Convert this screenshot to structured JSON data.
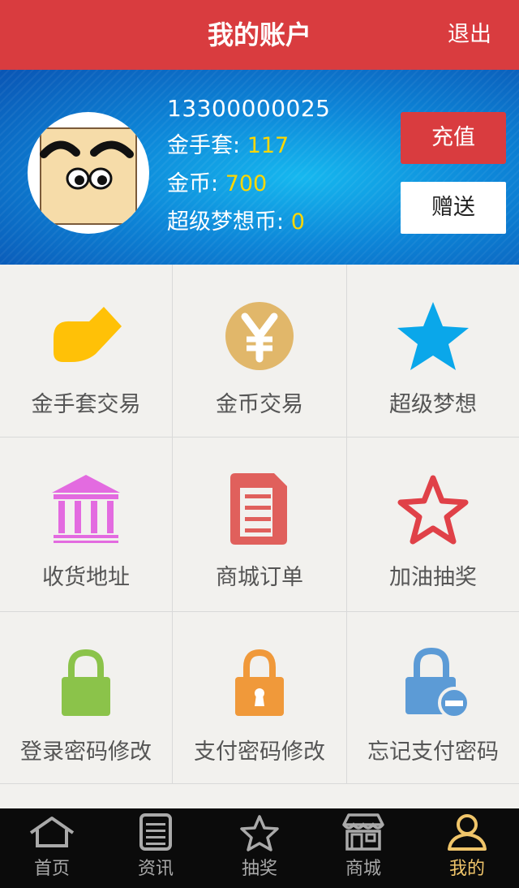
{
  "header": {
    "title": "我的账户",
    "logout_label": "退出"
  },
  "profile": {
    "phone": "13300000025",
    "glove_label": "金手套:",
    "glove_value": "117",
    "coin_label": "金币:",
    "coin_value": "700",
    "dream_label": "超级梦想币:",
    "dream_value": "0",
    "recharge_label": "充值",
    "gift_label": "赠送"
  },
  "grid": {
    "items": [
      {
        "label": "金手套交易",
        "icon": "glove-icon",
        "color": "#ffc107"
      },
      {
        "label": "金币交易",
        "icon": "yen-coin-icon",
        "color": "#e1b76a"
      },
      {
        "label": "超级梦想",
        "icon": "star-filled-icon",
        "color": "#0aa7ea"
      },
      {
        "label": "收货地址",
        "icon": "bank-building-icon",
        "color": "#e36be0"
      },
      {
        "label": "商城订单",
        "icon": "document-icon",
        "color": "#e0605c"
      },
      {
        "label": "加油抽奖",
        "icon": "star-outline-icon",
        "color": "#e04148"
      },
      {
        "label": "登录密码修改",
        "icon": "lock-green-icon",
        "color": "#8bc34a"
      },
      {
        "label": "支付密码修改",
        "icon": "lock-keyhole-icon",
        "color": "#f0993a"
      },
      {
        "label": "忘记支付密码",
        "icon": "lock-minus-icon",
        "color": "#5c9bd6"
      }
    ]
  },
  "tabbar": {
    "items": [
      {
        "label": "首页",
        "icon": "home-icon",
        "active": false
      },
      {
        "label": "资讯",
        "icon": "news-icon",
        "active": false
      },
      {
        "label": "抽奖",
        "icon": "star-icon",
        "active": false
      },
      {
        "label": "商城",
        "icon": "shop-icon",
        "active": false
      },
      {
        "label": "我的",
        "icon": "user-icon",
        "active": true
      }
    ]
  },
  "colors": {
    "header": "#d93c3f",
    "accent_value": "#ffd700",
    "tab_active": "#f0c56a"
  }
}
